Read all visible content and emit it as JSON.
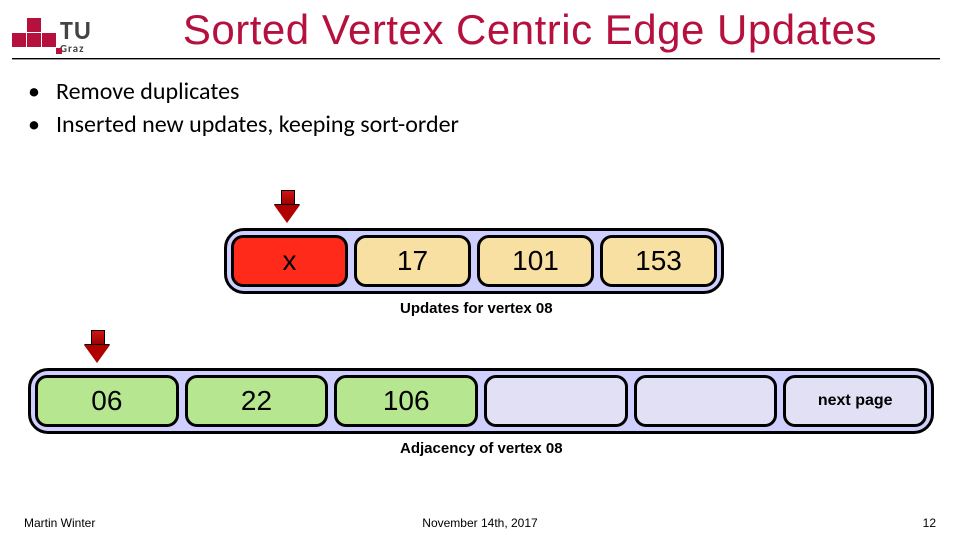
{
  "header": {
    "logo": {
      "tu": "TU",
      "graz": "Graz"
    },
    "title": "Sorted Vertex Centric Edge Updates"
  },
  "bullets": [
    "Remove duplicates",
    "Inserted new updates, keeping sort-order"
  ],
  "updates_row": {
    "cells": [
      "x",
      "17",
      "101",
      "153"
    ],
    "caption": "Updates for vertex 08"
  },
  "adjacency_row": {
    "cells": [
      "06",
      "22",
      "106",
      "",
      "",
      "next page"
    ],
    "caption": "Adjacency of vertex 08"
  },
  "footer": {
    "author": "Martin Winter",
    "date": "November 14th, 2017",
    "page": "12"
  }
}
